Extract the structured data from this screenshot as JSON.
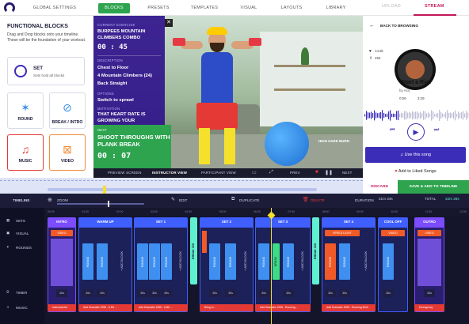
{
  "topnav": {
    "tabs": [
      "GLOBAL SETTINGS",
      "BLOCKS",
      "PRESETS",
      "TEMPLATES",
      "VISUAL",
      "LAYOUTS",
      "LIBRARY"
    ],
    "active": "BLOCKS",
    "right_tabs": [
      "UPLOAD",
      "STREAM"
    ],
    "right_active": "STREAM"
  },
  "left_panel": {
    "title": "FUNCTIONAL BLOCKS",
    "description": "Drag and Drop blocks onto your timeline. These will be the foundation of your workout.",
    "set_block": {
      "label": "SET",
      "desc": "Sets hold all blocks"
    },
    "blocks": [
      {
        "label": "ROUND",
        "icon": "round-icon"
      },
      {
        "label": "BREAK / INTRO",
        "icon": "break-icon"
      },
      {
        "label": "MUSIC",
        "icon": "music-icon"
      },
      {
        "label": "VIDEO",
        "icon": "video-icon"
      }
    ]
  },
  "exercise_panel": {
    "current_label": "CURRENT EXERCISE",
    "current_name": "BURPEES MOUNTAIN CLIMBERS COMBO",
    "current_time": "00 : 45",
    "description_label": "DESCRIPTION",
    "description_lines": [
      "Chest to Floor",
      "4 Mountain Climbers (24)",
      "Back Straight"
    ],
    "options_label": "OPTIONS",
    "options_text": "Switch to sprawl",
    "motivation_label": "MOTIVATION",
    "motivation_text": "THAT HEART RATE IS GROWING YOUR",
    "next_label": "NEXT",
    "next_name": "SHOOT THROUGHS WITH PLANK BREAK",
    "next_time": "00 : 07",
    "hr_badge": "HIGH HARD BURN"
  },
  "video_controls": {
    "preview": "PREVIEW SCREEN",
    "instructor": "INSTRUCTOR VIEW",
    "participant": "PARTICIPANT VIEW",
    "prev": "PREV",
    "next": "NEXT"
  },
  "stream": {
    "back": "BACK TO BROWSING",
    "likes": "14.5k",
    "shares": "450",
    "song_title": "Start a Riot",
    "song_meta": "by Aloj",
    "time_current": "0:59",
    "time_total": "3:29",
    "use_song": "Use this song",
    "liked": "Add to Liked Songs",
    "discard": "DISCARD",
    "save": "SAVE & ADD TO TIMELINE"
  },
  "timeline": {
    "label": "TIMELINE",
    "zoom": "ZOOM",
    "edit": "EDIT",
    "duplicate": "DUPLICATE",
    "delete": "DELETE",
    "duration_label": "DURATION",
    "duration_value": "21m 34s",
    "total_label": "TOTAL",
    "total_value": "34m 26s",
    "side": [
      "SETS",
      "VISUAL",
      "ROUNDS",
      "TIMER",
      "MUSIC"
    ],
    "ruler": [
      "00:00",
      "01:00",
      "02:00",
      "03:00",
      "04:00",
      "05:00",
      "06:00",
      "07:00",
      "08:00",
      "09:00",
      "10:00",
      "11:00",
      "12:00"
    ],
    "segments": [
      {
        "name": "INTRO",
        "badge": "VIDEO",
        "time": "30s"
      },
      {
        "name": "WARM UP",
        "time": "30s"
      },
      {
        "name": "SET 1",
        "time": "30s"
      },
      {
        "name": "SET 2",
        "time": "30s"
      },
      {
        "name": "SET 3",
        "time": "30s"
      },
      {
        "name": "SET 4",
        "badge": "SPEED LIGHT",
        "time": "30s"
      },
      {
        "name": "COOL OFF",
        "badge": "VIDEO",
        "time": "30s"
      },
      {
        "name": "OUTRO",
        "badge": "VIDEO",
        "time": "30s"
      }
    ],
    "round_label": "ROUND",
    "break_label": "BREAK 30S",
    "break2_label": "BREAK",
    "add_block": "+ ADD BLOCK",
    "music_tracks": [
      "Instrumental",
      "Add Dramatic 1995 - A Bit ...",
      "Bring to ...",
      "Add Dramatic 1995 - Running...",
      "Add Dramatic 1995 - Running Both",
      "Emergency"
    ]
  }
}
